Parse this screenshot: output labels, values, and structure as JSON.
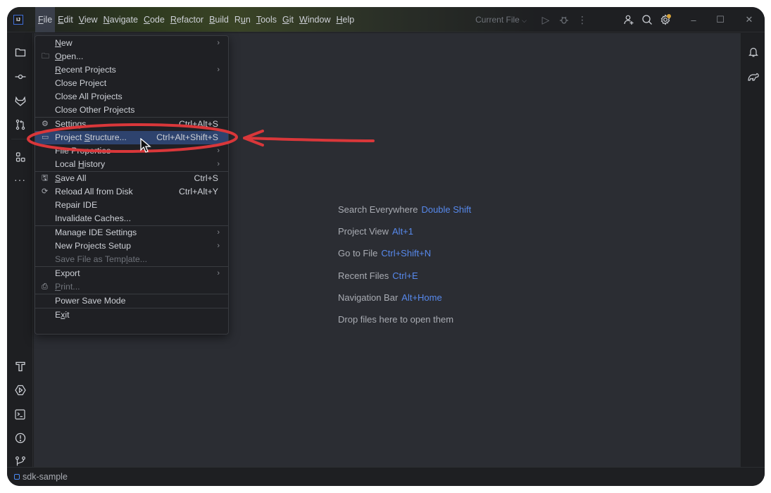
{
  "titlebar": {
    "app_logo": "IJ",
    "menus": [
      {
        "label": "File",
        "mnemonic_index": 0,
        "active": true
      },
      {
        "label": "Edit",
        "mnemonic_index": 0
      },
      {
        "label": "View",
        "mnemonic_index": 0
      },
      {
        "label": "Navigate",
        "mnemonic_index": 0
      },
      {
        "label": "Code",
        "mnemonic_index": 0
      },
      {
        "label": "Refactor",
        "mnemonic_index": 0
      },
      {
        "label": "Build",
        "mnemonic_index": 0
      },
      {
        "label": "Run",
        "mnemonic_index": 1
      },
      {
        "label": "Tools",
        "mnemonic_index": 0
      },
      {
        "label": "Git",
        "mnemonic_index": 0
      },
      {
        "label": "Window",
        "mnemonic_index": 0
      },
      {
        "label": "Help",
        "mnemonic_index": 0
      }
    ],
    "run_config": "Current File",
    "run_config_chevron": "⌵",
    "icons": {
      "run": "▷",
      "debug": "☼",
      "more": "⋮",
      "add_user": "⚇",
      "search": "⌕",
      "settings": "⚙",
      "minimize": "–",
      "maximize": "☐",
      "close": "✕"
    }
  },
  "file_menu": {
    "items": [
      {
        "label": "New",
        "mn": 0,
        "submenu": true
      },
      {
        "label": "Open...",
        "mn": 0,
        "icon": "🗀"
      },
      {
        "label": "Recent Projects",
        "mn": 0,
        "submenu": true
      },
      {
        "label": "Close Project"
      },
      {
        "label": "Close All Projects"
      },
      {
        "label": "Close Other Projects",
        "sep_after": true
      },
      {
        "label": "Settings...",
        "mn": 1,
        "icon": "⚙",
        "shortcut": "Ctrl+Alt+S"
      },
      {
        "label": "Project Structure...",
        "mn": 8,
        "icon": "▭",
        "shortcut": "Ctrl+Alt+Shift+S",
        "highlighted": true
      },
      {
        "label": "File Properties",
        "submenu": true
      },
      {
        "label": "Local History",
        "mn": 6,
        "submenu": true,
        "sep_after": true
      },
      {
        "label": "Save All",
        "mn": 0,
        "icon": "🖫",
        "shortcut": "Ctrl+S"
      },
      {
        "label": "Reload All from Disk",
        "icon": "⟳",
        "shortcut": "Ctrl+Alt+Y"
      },
      {
        "label": "Repair IDE"
      },
      {
        "label": "Invalidate Caches...",
        "sep_after": true
      },
      {
        "label": "Manage IDE Settings",
        "submenu": true
      },
      {
        "label": "New Projects Setup",
        "submenu": true
      },
      {
        "label": "Save File as Template...",
        "disabled": true,
        "mn": 17,
        "sep_after": true
      },
      {
        "label": "Export",
        "submenu": true
      },
      {
        "label": "Print...",
        "mn": 0,
        "icon": "⎙",
        "disabled": true,
        "sep_after": true
      },
      {
        "label": "Power Save Mode",
        "sep_after": true
      },
      {
        "label": "Exit",
        "mn": 1
      }
    ],
    "submenu_arrow": "›"
  },
  "left_toolbar": {
    "top": [
      "project-folder",
      "commit",
      "gitlab",
      "pull-requests",
      "structure",
      "more"
    ],
    "bottom": [
      "build",
      "services",
      "terminal",
      "problems",
      "git"
    ]
  },
  "right_toolbar": [
    "notifications",
    "gradle"
  ],
  "welcome": {
    "rows": [
      {
        "text": "Search Everywhere",
        "shortcut": "Double Shift"
      },
      {
        "text": "Project View",
        "shortcut": "Alt+1"
      },
      {
        "text": "Go to File",
        "shortcut": "Ctrl+Shift+N"
      },
      {
        "text": "Recent Files",
        "shortcut": "Ctrl+E"
      },
      {
        "text": "Navigation Bar",
        "shortcut": "Alt+Home"
      },
      {
        "text": "Drop files here to open them",
        "shortcut": ""
      }
    ]
  },
  "statusbar": {
    "project": "sdk-sample"
  },
  "annotation": {
    "color": "#d9373a",
    "target": "Project Structure..."
  }
}
